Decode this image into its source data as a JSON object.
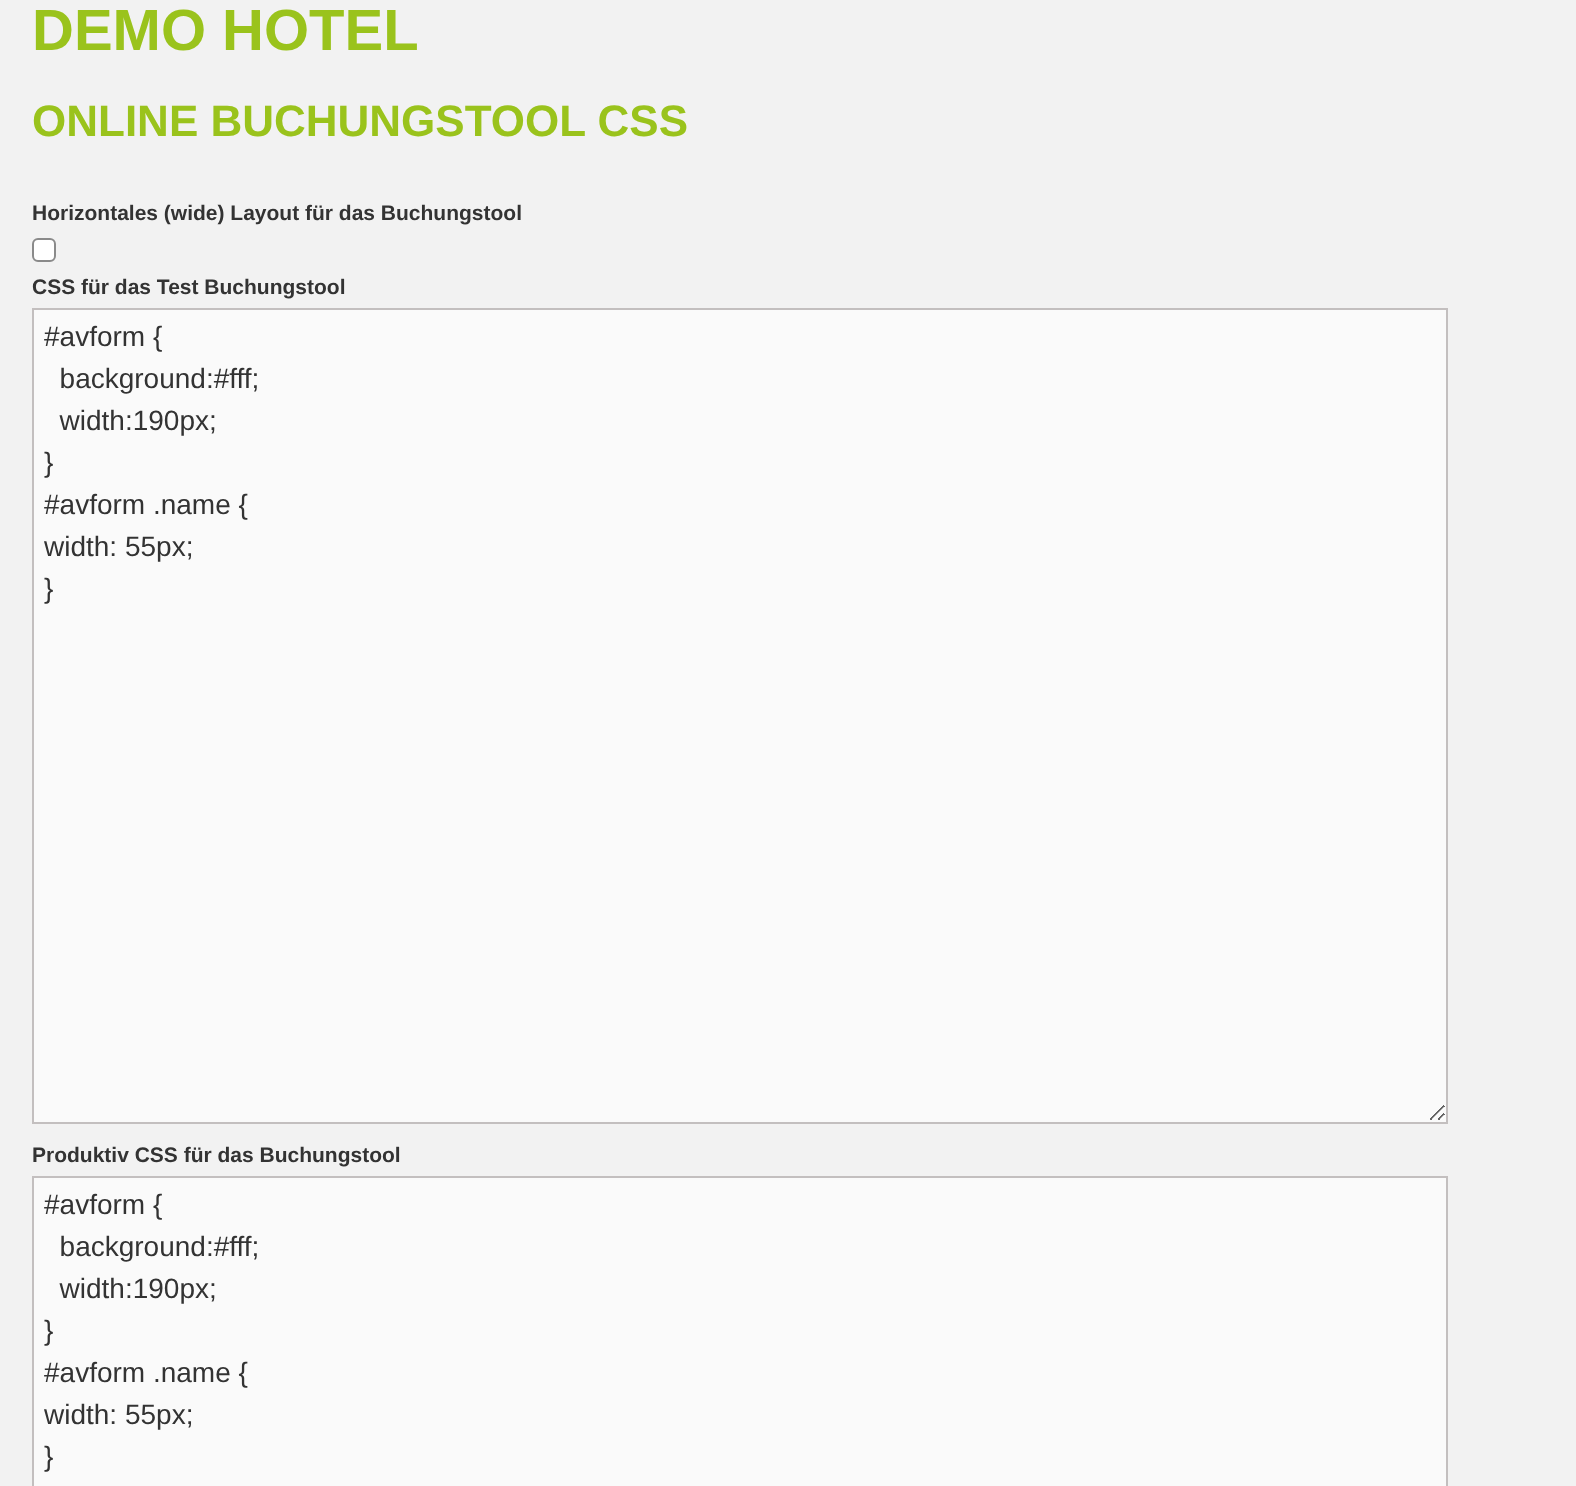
{
  "title": "DEMO HOTEL",
  "subtitle": "ONLINE BUCHUNGSTOOL CSS",
  "fields": [
    {
      "kind": "checkbox",
      "label": "Horizontales (wide) Layout für das Buchungstool",
      "checked": false
    },
    {
      "kind": "textarea",
      "label": "CSS für das Test Buchungstool",
      "value": "#avform {\n  background:#fff;\n  width:190px;\n}\n#avform .name {\nwidth: 55px;\n}"
    },
    {
      "kind": "textarea",
      "label": "Produktiv CSS für das Buchungstool",
      "value": "#avform {\n  background:#fff;\n  width:190px;\n}\n#avform .name {\nwidth: 55px;\n}"
    }
  ]
}
